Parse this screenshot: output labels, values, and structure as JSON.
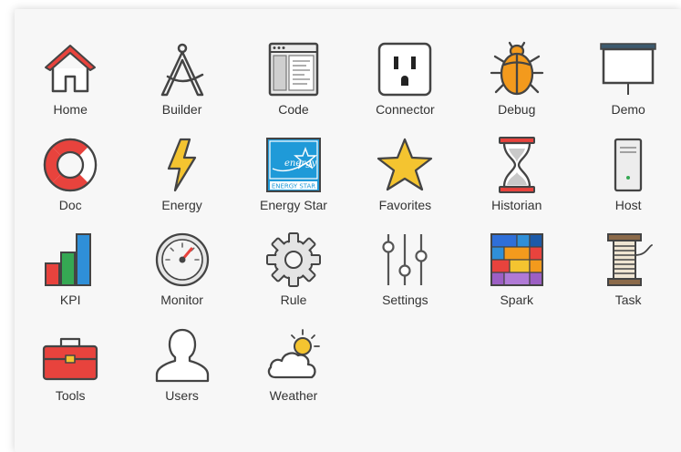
{
  "apps": [
    {
      "id": "home",
      "label": "Home",
      "icon": "home-icon"
    },
    {
      "id": "builder",
      "label": "Builder",
      "icon": "compass-icon"
    },
    {
      "id": "code",
      "label": "Code",
      "icon": "code-window-icon"
    },
    {
      "id": "connector",
      "label": "Connector",
      "icon": "power-outlet-icon"
    },
    {
      "id": "debug",
      "label": "Debug",
      "icon": "bug-icon"
    },
    {
      "id": "demo",
      "label": "Demo",
      "icon": "projector-screen-icon"
    },
    {
      "id": "doc",
      "label": "Doc",
      "icon": "lifebuoy-icon"
    },
    {
      "id": "energy",
      "label": "Energy",
      "icon": "lightning-bolt-icon"
    },
    {
      "id": "energy-star",
      "label": "Energy Star",
      "icon": "energy-star-logo-icon",
      "logo_text": "ENERGY STAR"
    },
    {
      "id": "favorites",
      "label": "Favorites",
      "icon": "star-icon"
    },
    {
      "id": "historian",
      "label": "Historian",
      "icon": "hourglass-icon"
    },
    {
      "id": "host",
      "label": "Host",
      "icon": "server-tower-icon"
    },
    {
      "id": "kpi",
      "label": "KPI",
      "icon": "bar-chart-icon"
    },
    {
      "id": "monitor",
      "label": "Monitor",
      "icon": "gauge-icon"
    },
    {
      "id": "rule",
      "label": "Rule",
      "icon": "gear-icon"
    },
    {
      "id": "settings",
      "label": "Settings",
      "icon": "sliders-icon"
    },
    {
      "id": "spark",
      "label": "Spark",
      "icon": "colored-blocks-icon"
    },
    {
      "id": "task",
      "label": "Task",
      "icon": "thread-spool-icon"
    },
    {
      "id": "tools",
      "label": "Tools",
      "icon": "toolbox-icon"
    },
    {
      "id": "users",
      "label": "Users",
      "icon": "user-silhouette-icon"
    },
    {
      "id": "weather",
      "label": "Weather",
      "icon": "sun-cloud-icon"
    }
  ],
  "colors": {
    "background": "#f7f7f7",
    "label_text": "#333333",
    "outline": "#444444",
    "red": "#e8433d",
    "yellow": "#f4c430",
    "blue": "#2f8fd8",
    "green": "#35a853",
    "orange": "#f39a1d",
    "purple": "#9c5fc4"
  }
}
